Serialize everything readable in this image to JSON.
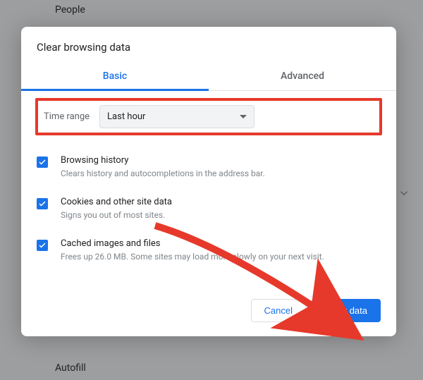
{
  "background": {
    "section_top": "People",
    "section_bottom": "Autofill"
  },
  "dialog": {
    "title": "Clear browsing data",
    "tabs": {
      "basic": "Basic",
      "advanced": "Advanced"
    },
    "timerange": {
      "label": "Time range",
      "value": "Last hour"
    },
    "options": [
      {
        "title": "Browsing history",
        "desc": "Clears history and autocompletions in the address bar."
      },
      {
        "title": "Cookies and other site data",
        "desc": "Signs you out of most sites."
      },
      {
        "title": "Cached images and files",
        "desc": "Frees up 26.0 MB. Some sites may load more slowly on your next visit."
      }
    ],
    "buttons": {
      "cancel": "Cancel",
      "clear": "Clear data"
    }
  }
}
